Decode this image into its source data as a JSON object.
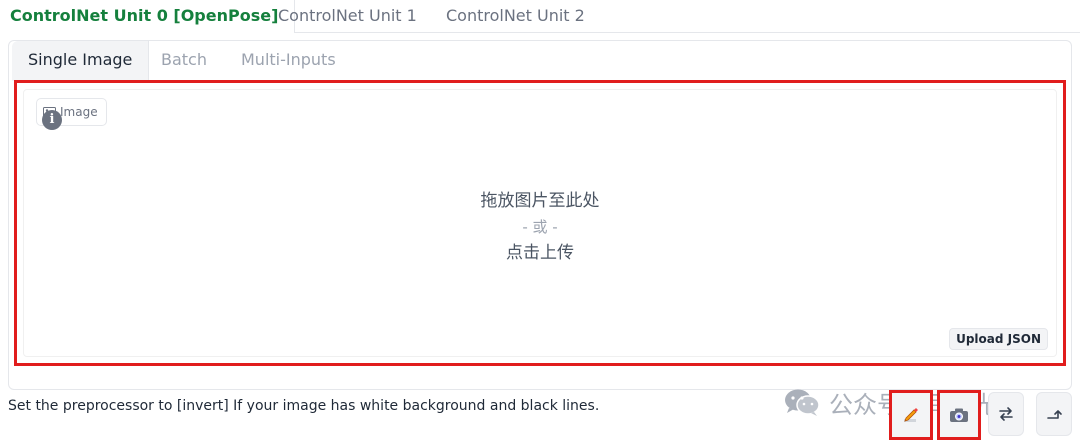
{
  "unit_tabs": [
    {
      "label": "ControlNet Unit 0 [OpenPose]",
      "active": true
    },
    {
      "label": "ControlNet Unit 1",
      "active": false
    },
    {
      "label": "ControlNet Unit 2",
      "active": false
    }
  ],
  "sub_tabs": [
    {
      "label": "Single Image",
      "active": true
    },
    {
      "label": "Batch",
      "active": false
    },
    {
      "label": "Multi-Inputs",
      "active": false
    }
  ],
  "upload": {
    "image_label": "Image",
    "drop_text": "拖放图片至此处",
    "or_text": "- 或 -",
    "click_text": "点击上传",
    "upload_json_label": "Upload JSON"
  },
  "hint": "Set the preprocessor to [invert] If your image has white background and black lines.",
  "watermark": "公众号 · 闫承光",
  "tools": [
    {
      "name": "edit-button",
      "icon": "pencil-icon"
    },
    {
      "name": "camera-button",
      "icon": "camera-icon"
    },
    {
      "name": "swap-dimensions-button",
      "icon": "swap-arrows-icon"
    },
    {
      "name": "send-dimensions-button",
      "icon": "corner-arrow-icon"
    }
  ],
  "colors": {
    "active_unit_tab": "#15803d",
    "highlight_border": "#e11d1d"
  }
}
